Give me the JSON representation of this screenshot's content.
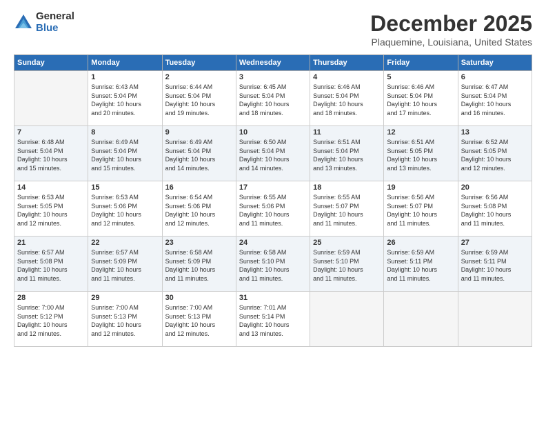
{
  "logo": {
    "general": "General",
    "blue": "Blue"
  },
  "title": {
    "month": "December 2025",
    "location": "Plaquemine, Louisiana, United States"
  },
  "headers": [
    "Sunday",
    "Monday",
    "Tuesday",
    "Wednesday",
    "Thursday",
    "Friday",
    "Saturday"
  ],
  "weeks": [
    [
      {
        "day": "",
        "info": ""
      },
      {
        "day": "1",
        "info": "Sunrise: 6:43 AM\nSunset: 5:04 PM\nDaylight: 10 hours\nand 20 minutes."
      },
      {
        "day": "2",
        "info": "Sunrise: 6:44 AM\nSunset: 5:04 PM\nDaylight: 10 hours\nand 19 minutes."
      },
      {
        "day": "3",
        "info": "Sunrise: 6:45 AM\nSunset: 5:04 PM\nDaylight: 10 hours\nand 18 minutes."
      },
      {
        "day": "4",
        "info": "Sunrise: 6:46 AM\nSunset: 5:04 PM\nDaylight: 10 hours\nand 18 minutes."
      },
      {
        "day": "5",
        "info": "Sunrise: 6:46 AM\nSunset: 5:04 PM\nDaylight: 10 hours\nand 17 minutes."
      },
      {
        "day": "6",
        "info": "Sunrise: 6:47 AM\nSunset: 5:04 PM\nDaylight: 10 hours\nand 16 minutes."
      }
    ],
    [
      {
        "day": "7",
        "info": "Sunrise: 6:48 AM\nSunset: 5:04 PM\nDaylight: 10 hours\nand 15 minutes."
      },
      {
        "day": "8",
        "info": "Sunrise: 6:49 AM\nSunset: 5:04 PM\nDaylight: 10 hours\nand 15 minutes."
      },
      {
        "day": "9",
        "info": "Sunrise: 6:49 AM\nSunset: 5:04 PM\nDaylight: 10 hours\nand 14 minutes."
      },
      {
        "day": "10",
        "info": "Sunrise: 6:50 AM\nSunset: 5:04 PM\nDaylight: 10 hours\nand 14 minutes."
      },
      {
        "day": "11",
        "info": "Sunrise: 6:51 AM\nSunset: 5:04 PM\nDaylight: 10 hours\nand 13 minutes."
      },
      {
        "day": "12",
        "info": "Sunrise: 6:51 AM\nSunset: 5:05 PM\nDaylight: 10 hours\nand 13 minutes."
      },
      {
        "day": "13",
        "info": "Sunrise: 6:52 AM\nSunset: 5:05 PM\nDaylight: 10 hours\nand 12 minutes."
      }
    ],
    [
      {
        "day": "14",
        "info": "Sunrise: 6:53 AM\nSunset: 5:05 PM\nDaylight: 10 hours\nand 12 minutes."
      },
      {
        "day": "15",
        "info": "Sunrise: 6:53 AM\nSunset: 5:06 PM\nDaylight: 10 hours\nand 12 minutes."
      },
      {
        "day": "16",
        "info": "Sunrise: 6:54 AM\nSunset: 5:06 PM\nDaylight: 10 hours\nand 12 minutes."
      },
      {
        "day": "17",
        "info": "Sunrise: 6:55 AM\nSunset: 5:06 PM\nDaylight: 10 hours\nand 11 minutes."
      },
      {
        "day": "18",
        "info": "Sunrise: 6:55 AM\nSunset: 5:07 PM\nDaylight: 10 hours\nand 11 minutes."
      },
      {
        "day": "19",
        "info": "Sunrise: 6:56 AM\nSunset: 5:07 PM\nDaylight: 10 hours\nand 11 minutes."
      },
      {
        "day": "20",
        "info": "Sunrise: 6:56 AM\nSunset: 5:08 PM\nDaylight: 10 hours\nand 11 minutes."
      }
    ],
    [
      {
        "day": "21",
        "info": "Sunrise: 6:57 AM\nSunset: 5:08 PM\nDaylight: 10 hours\nand 11 minutes."
      },
      {
        "day": "22",
        "info": "Sunrise: 6:57 AM\nSunset: 5:09 PM\nDaylight: 10 hours\nand 11 minutes."
      },
      {
        "day": "23",
        "info": "Sunrise: 6:58 AM\nSunset: 5:09 PM\nDaylight: 10 hours\nand 11 minutes."
      },
      {
        "day": "24",
        "info": "Sunrise: 6:58 AM\nSunset: 5:10 PM\nDaylight: 10 hours\nand 11 minutes."
      },
      {
        "day": "25",
        "info": "Sunrise: 6:59 AM\nSunset: 5:10 PM\nDaylight: 10 hours\nand 11 minutes."
      },
      {
        "day": "26",
        "info": "Sunrise: 6:59 AM\nSunset: 5:11 PM\nDaylight: 10 hours\nand 11 minutes."
      },
      {
        "day": "27",
        "info": "Sunrise: 6:59 AM\nSunset: 5:11 PM\nDaylight: 10 hours\nand 11 minutes."
      }
    ],
    [
      {
        "day": "28",
        "info": "Sunrise: 7:00 AM\nSunset: 5:12 PM\nDaylight: 10 hours\nand 12 minutes."
      },
      {
        "day": "29",
        "info": "Sunrise: 7:00 AM\nSunset: 5:13 PM\nDaylight: 10 hours\nand 12 minutes."
      },
      {
        "day": "30",
        "info": "Sunrise: 7:00 AM\nSunset: 5:13 PM\nDaylight: 10 hours\nand 12 minutes."
      },
      {
        "day": "31",
        "info": "Sunrise: 7:01 AM\nSunset: 5:14 PM\nDaylight: 10 hours\nand 13 minutes."
      },
      {
        "day": "",
        "info": ""
      },
      {
        "day": "",
        "info": ""
      },
      {
        "day": "",
        "info": ""
      }
    ]
  ]
}
